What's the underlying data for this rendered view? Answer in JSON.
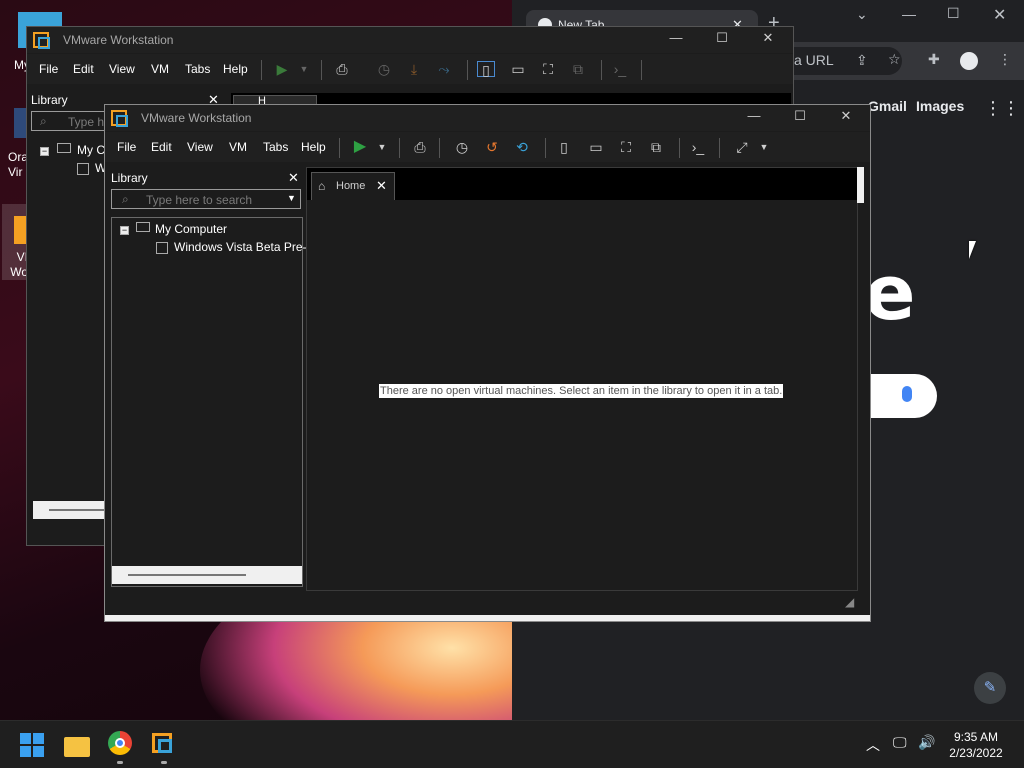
{
  "desktop": {
    "icons": [
      {
        "label": "My C"
      },
      {
        "label": "Ora\nVir"
      },
      {
        "label": "VI\nWo"
      }
    ]
  },
  "chrome": {
    "tab_title": "New Tab",
    "new_tab_symbol": "+",
    "omnibox_text": "a URL",
    "links": [
      "Gmail",
      "Images"
    ],
    "logo_fragment": "e"
  },
  "vmware_back": {
    "title": "VMware Workstation",
    "menu": [
      "File",
      "Edit",
      "View",
      "VM",
      "Tabs",
      "Help"
    ],
    "library_title": "Library",
    "search_placeholder": "Type he",
    "tree": [
      "My C",
      "W"
    ],
    "tab_label": "H"
  },
  "vmware_front": {
    "title": "VMware Workstation",
    "menu": [
      "File",
      "Edit",
      "View",
      "VM",
      "Tabs",
      "Help"
    ],
    "library_title": "Library",
    "library_close": "✕",
    "search_placeholder": "Type here to search",
    "tree": {
      "root": "My Computer",
      "child": "Windows Vista Beta Pre-"
    },
    "home_tab": "Home",
    "empty_message": "There are no open virtual machines. Select an item in the library to open it in a tab."
  },
  "taskbar": {
    "time": "9:35 AM",
    "date": "2/23/2022"
  },
  "colors": {
    "accent_green": "#2ea043",
    "vmware_orange": "#f4a022",
    "vmware_blue": "#3aa3d9",
    "google_blue": "#4285f4"
  }
}
